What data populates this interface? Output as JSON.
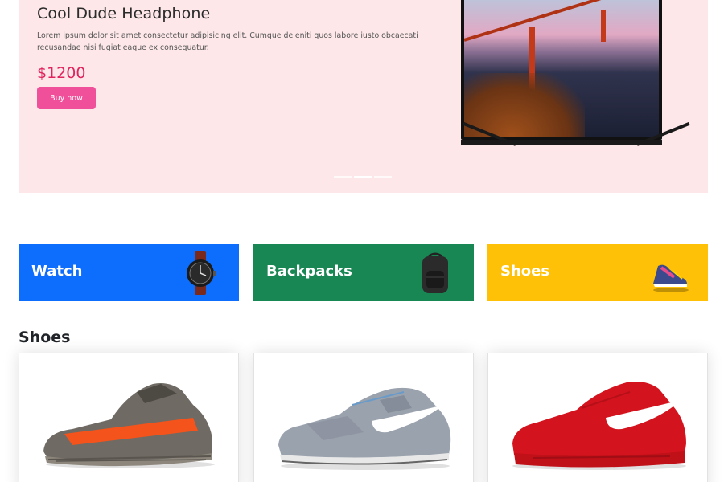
{
  "hero": {
    "title": "Cool Dude Headphone",
    "description": "Lorem ipsum dolor sit amet consectetur adipisicing elit. Cumque deleniti quos labore iusto obcaecati recusandae nisi fugiat eaque ex consequatur.",
    "price": "$1200",
    "buy_label": "Buy now",
    "carousel_slides": 3,
    "active_slide": 2
  },
  "categories": [
    {
      "label": "Watch",
      "color": "#0d6efd",
      "icon": "wristwatch-icon"
    },
    {
      "label": "Backpacks",
      "color": "#198754",
      "icon": "backpack-icon"
    },
    {
      "label": "Shoes",
      "color": "#ffc107",
      "icon": "sneaker-icon"
    }
  ],
  "section": {
    "title": "Shoes"
  },
  "products": [
    {
      "icon": "grey-orange-sneaker-image"
    },
    {
      "icon": "grey-pattern-nike-sneaker-image"
    },
    {
      "icon": "red-nike-sneaker-image"
    }
  ],
  "colors": {
    "hero_bg": "#fde7e9",
    "price": "#e0245e",
    "buy_button": "#f0509a"
  }
}
